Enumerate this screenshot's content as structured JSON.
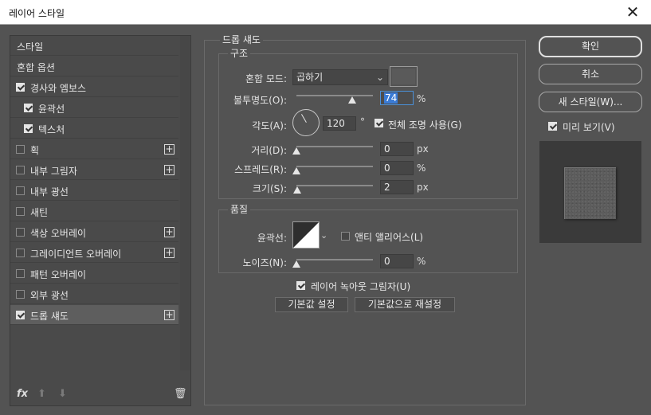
{
  "window": {
    "title": "레이어 스타일",
    "close_glyph": "✕"
  },
  "styles": [
    {
      "label": "스타일",
      "checkbox": false,
      "checked": false,
      "plus": false,
      "selected": false,
      "indent": false
    },
    {
      "label": "혼합 옵션",
      "checkbox": false,
      "checked": false,
      "plus": false,
      "selected": false,
      "indent": false
    },
    {
      "label": "경사와 엠보스",
      "checkbox": true,
      "checked": true,
      "plus": false,
      "selected": false,
      "indent": false
    },
    {
      "label": "윤곽선",
      "checkbox": true,
      "checked": true,
      "plus": false,
      "selected": false,
      "indent": true
    },
    {
      "label": "텍스처",
      "checkbox": true,
      "checked": true,
      "plus": false,
      "selected": false,
      "indent": true
    },
    {
      "label": "획",
      "checkbox": true,
      "checked": false,
      "plus": true,
      "selected": false,
      "indent": false
    },
    {
      "label": "내부 그림자",
      "checkbox": true,
      "checked": false,
      "plus": true,
      "selected": false,
      "indent": false
    },
    {
      "label": "내부 광선",
      "checkbox": true,
      "checked": false,
      "plus": false,
      "selected": false,
      "indent": false
    },
    {
      "label": "새틴",
      "checkbox": true,
      "checked": false,
      "plus": false,
      "selected": false,
      "indent": false
    },
    {
      "label": "색상 오버레이",
      "checkbox": true,
      "checked": false,
      "plus": true,
      "selected": false,
      "indent": false
    },
    {
      "label": "그레이디언트 오버레이",
      "checkbox": true,
      "checked": false,
      "plus": true,
      "selected": false,
      "indent": false
    },
    {
      "label": "패턴 오버레이",
      "checkbox": true,
      "checked": false,
      "plus": false,
      "selected": false,
      "indent": false
    },
    {
      "label": "외부 광선",
      "checkbox": true,
      "checked": false,
      "plus": false,
      "selected": false,
      "indent": false
    },
    {
      "label": "드롭 섀도",
      "checkbox": true,
      "checked": true,
      "plus": true,
      "selected": true,
      "indent": false
    }
  ],
  "bottom_tools": {
    "fx": "fx",
    "up": "⬆",
    "down": "⬇",
    "trash": "🗑"
  },
  "drop_shadow": {
    "section_title": "드롭 섀도",
    "structure": {
      "title": "구조",
      "blend_mode_label": "혼합 모드:",
      "blend_mode_value": "곱하기",
      "opacity_label": "불투명도(O):",
      "opacity_value": "74",
      "opacity_unit": "%",
      "angle_label": "각도(A):",
      "angle_value": "120",
      "angle_unit": "°",
      "global_light_label": "전체 조명 사용(G)",
      "global_light_checked": true,
      "distance_label": "거리(D):",
      "distance_value": "0",
      "distance_unit": "px",
      "spread_label": "스프레드(R):",
      "spread_value": "0",
      "spread_unit": "%",
      "size_label": "크기(S):",
      "size_value": "2",
      "size_unit": "px"
    },
    "quality": {
      "title": "품질",
      "contour_label": "윤곽선:",
      "anti_alias_label": "앤티 앨리어스(L)",
      "anti_alias_checked": false,
      "noise_label": "노이즈(N):",
      "noise_value": "0",
      "noise_unit": "%"
    },
    "knockout_label": "레이어 녹아웃 그림자(U)",
    "knockout_checked": true,
    "make_default": "기본값 설정",
    "reset_default": "기본값으로 재설정"
  },
  "right": {
    "ok": "확인",
    "cancel": "취소",
    "new_style": "새 스타일(W)...",
    "preview_label": "미리 보기(V)",
    "preview_checked": true
  },
  "colors": {
    "shadow_swatch": "#5a5a5a",
    "dialog_bg": "#535353"
  }
}
